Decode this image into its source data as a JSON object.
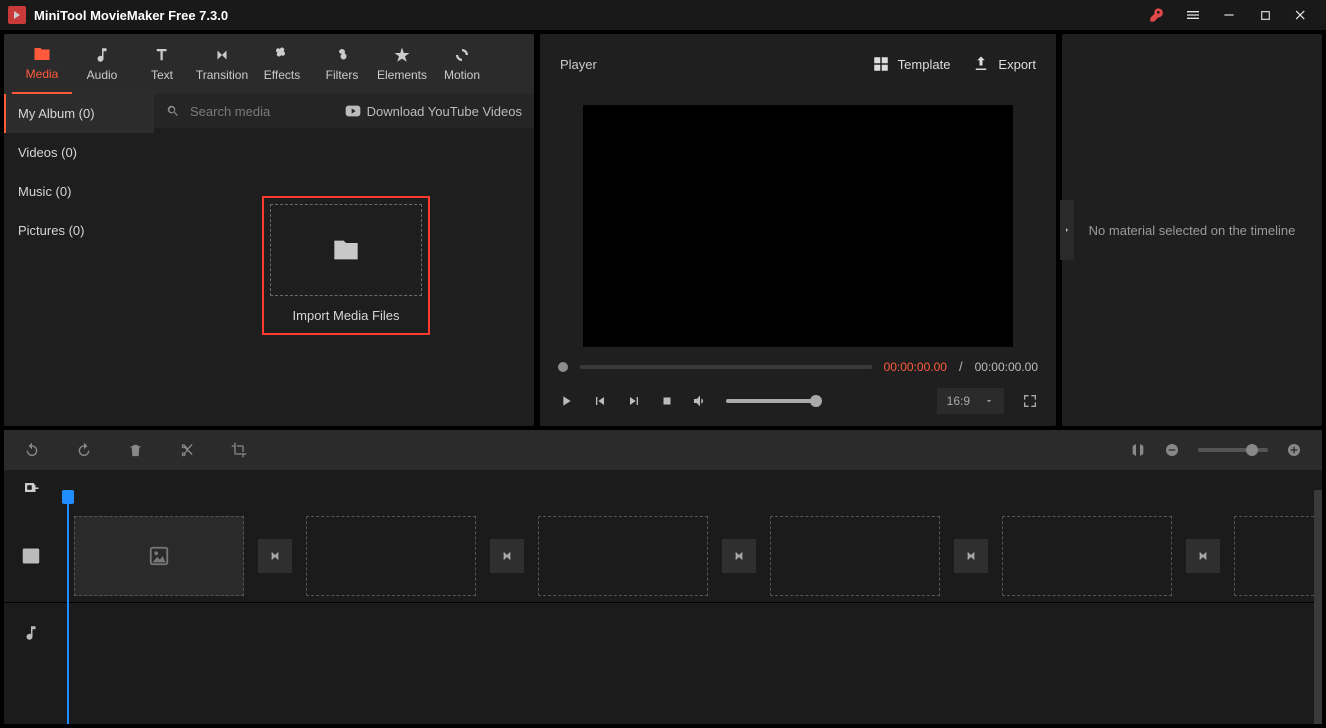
{
  "title": "MiniTool MovieMaker Free 7.3.0",
  "toolTabs": [
    {
      "label": "Media",
      "active": true
    },
    {
      "label": "Audio"
    },
    {
      "label": "Text"
    },
    {
      "label": "Transition"
    },
    {
      "label": "Effects"
    },
    {
      "label": "Filters"
    },
    {
      "label": "Elements"
    },
    {
      "label": "Motion"
    }
  ],
  "sideItems": [
    {
      "label": "My Album (0)",
      "selected": true
    },
    {
      "label": "Videos (0)"
    },
    {
      "label": "Music (0)"
    },
    {
      "label": "Pictures (0)"
    }
  ],
  "searchPlaceholder": "Search media",
  "ytDownload": "Download YouTube Videos",
  "importLabel": "Import Media Files",
  "player": {
    "title": "Player",
    "templateLabel": "Template",
    "exportLabel": "Export",
    "timeCurrent": "00:00:00.00",
    "timeTotal": "00:00:00.00",
    "aspect": "16:9"
  },
  "propMessage": "No material selected on the timeline"
}
